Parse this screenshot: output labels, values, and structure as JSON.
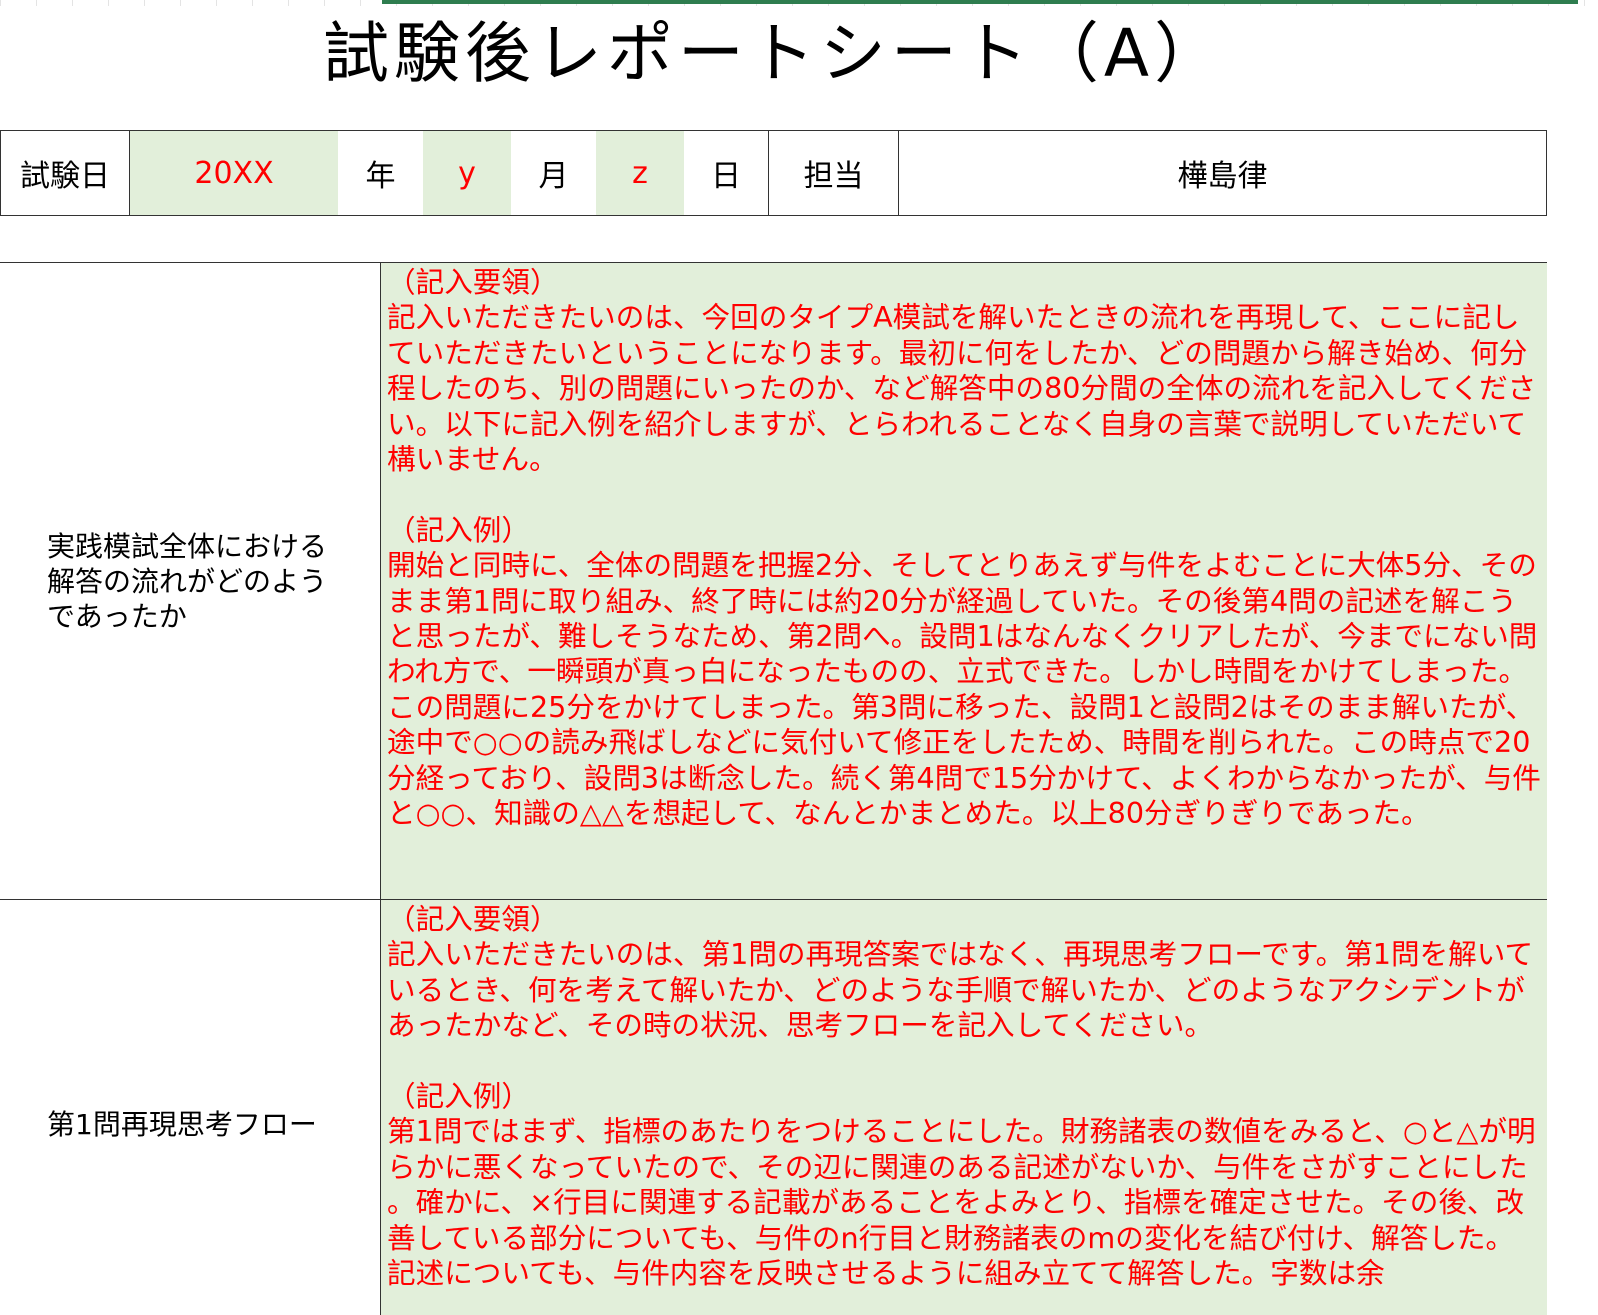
{
  "title": "試験後レポートシート（A）",
  "info": {
    "date_label": "試験日",
    "year_value": "20XX",
    "year_unit": "年",
    "month_value": "y",
    "month_unit": "月",
    "day_value": "z",
    "day_unit": "日",
    "person_label": "担当",
    "person_value": "樺島律"
  },
  "rows": [
    {
      "label": "実践模試全体における解答の流れがどのようであったか",
      "guide_heading": "（記入要領）",
      "guide_text": "記入いただきたいのは、今回のタイプA模試を解いたときの流れを再現して、ここに記していただきたいということになります。最初に何をしたか、どの問題から解き始め、何分程したのち、別の問題にいったのか、など解答中の80分間の全体の流れを記入してください。以下に記入例を紹介しますが、とらわれることなく自身の言葉で説明していただいて構いません。",
      "example_heading": "（記入例）",
      "example_text": "開始と同時に、全体の問題を把握2分、そしてとりあえず与件をよむことに大体5分、そのまま第1問に取り組み、終了時には約20分が経過していた。その後第4問の記述を解こうと思ったが、難しそうなため、第2問へ。設問1はなんなくクリアしたが、今までにない問われ方で、一瞬頭が真っ白になったものの、立式できた。しかし時間をかけてしまった。この問題に25分をかけてしまった。第3問に移った、設問1と設問2はそのまま解いたが、途中で○○の読み飛ばしなどに気付いて修正をしたため、時間を削られた。この時点で20分経っており、設問3は断念した。続く第4問で15分かけて、よくわからなかったが、与件と○○、知識の△△を想起して、なんとかまとめた。以上80分ぎりぎりであった。"
    },
    {
      "label": "第1問再現思考フロー",
      "guide_heading": "（記入要領）",
      "guide_text": "記入いただきたいのは、第1問の再現答案ではなく、再現思考フローです。第1問を解いているとき、何を考えて解いたか、どのような手順で解いたか、どのようなアクシデントがあったかなど、その時の状況、思考フローを記入してください。",
      "example_heading": "（記入例）",
      "example_text": "第1問ではまず、指標のあたりをつけることにした。財務諸表の数値をみると、○と△が明らかに悪くなっていたので、その辺に関連のある記述がないか、与件をさがすことにした。確かに、×行目に関連する記載があることをよみとり、指標を確定させた。その後、改善している部分についても、与件のn行目と財務諸表のmの変化を結び付け、解答した。記述についても、与件内容を反映させるように組み立てて解答した。字数は余"
    }
  ]
}
